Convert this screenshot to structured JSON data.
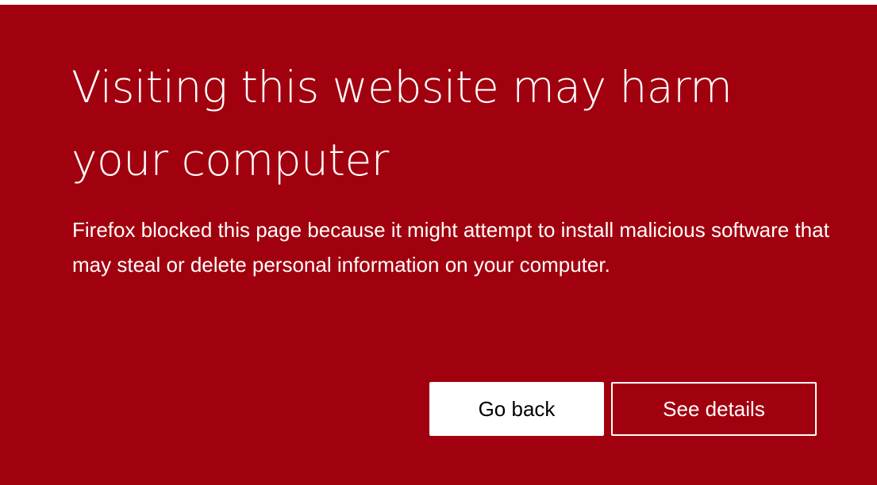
{
  "page": {
    "headline": "Visiting this website may harm your computer",
    "description": "Firefox blocked this page because it might attempt to install malicious software that may steal or delete personal information on your computer."
  },
  "buttons": {
    "go_back_label": "Go back",
    "see_details_label": "See details"
  },
  "colors": {
    "background": "#a1000e",
    "text": "#ffffff",
    "primary_button_bg": "#ffffff",
    "primary_button_text": "#000000"
  }
}
